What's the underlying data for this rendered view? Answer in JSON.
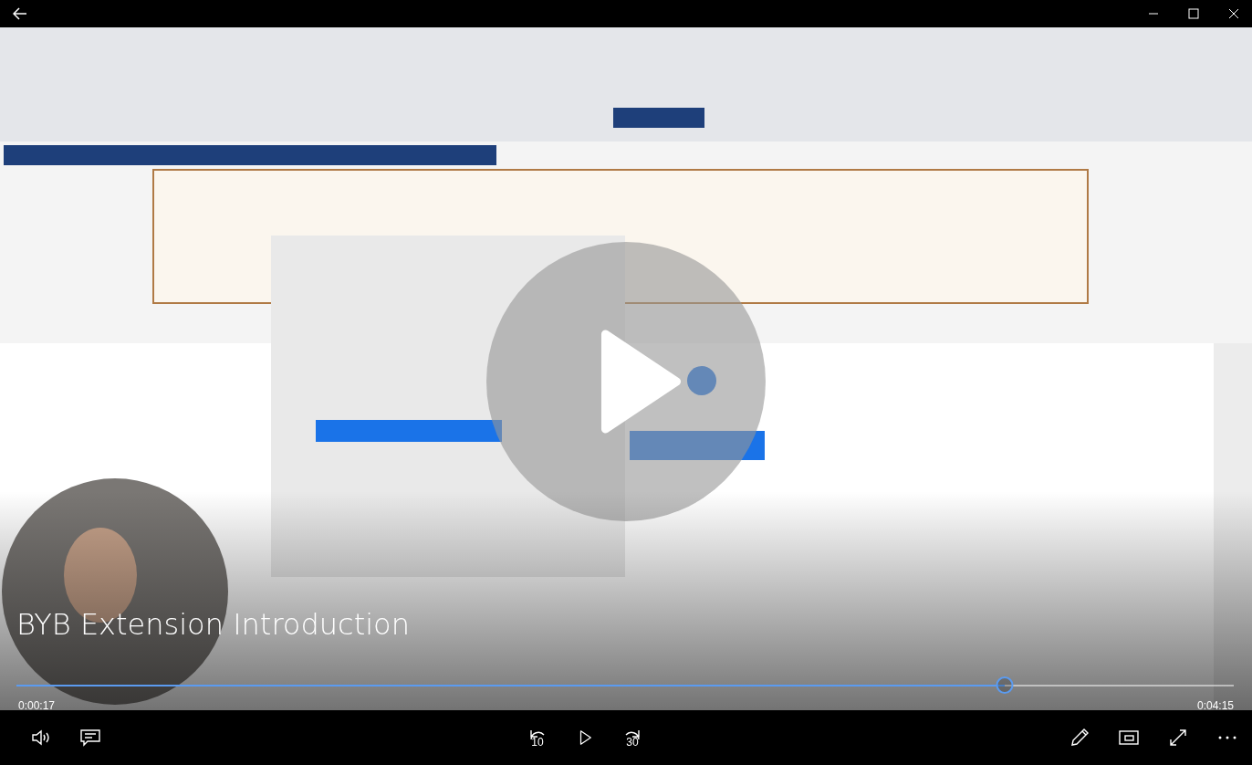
{
  "player": {
    "title": "BYB Extension Introduction",
    "playing": false
  },
  "progress": {
    "level": 0.812,
    "elapsed": "0:00:17",
    "duration": "0:04:15"
  },
  "controls": {
    "rewind_label": "10",
    "forward_label": "30"
  }
}
